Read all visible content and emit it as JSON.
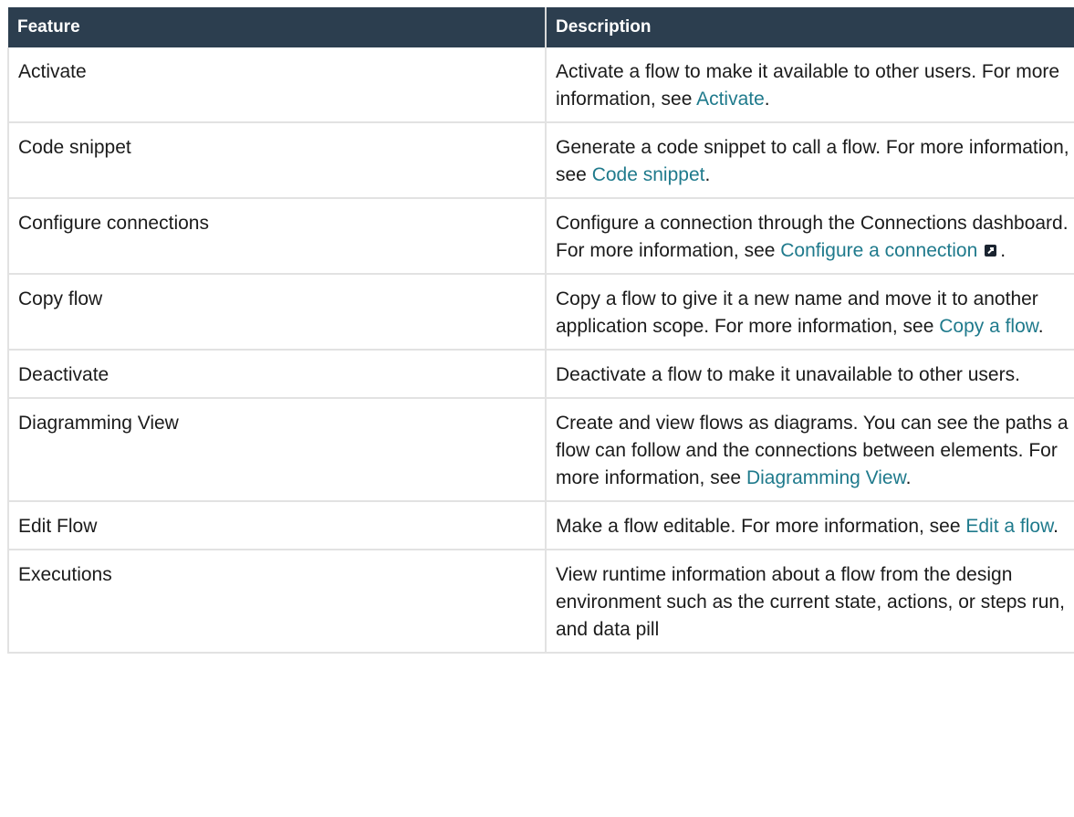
{
  "headers": {
    "feature": "Feature",
    "description": "Description"
  },
  "rows": [
    {
      "feature": "Activate",
      "desc_before": "Activate a flow to make it available to other users. For more information, see ",
      "link": "Activate",
      "desc_after": "."
    },
    {
      "feature": "Code snippet",
      "desc_before": "Generate a code snippet to call a flow. For more information, see ",
      "link": "Code snippet",
      "desc_after": "."
    },
    {
      "feature": "Configure connections",
      "desc_before": "Configure a connection through the Connections dashboard. For more information, see ",
      "link": "Configure a connection",
      "external_icon": "external-link-icon",
      "desc_after": "."
    },
    {
      "feature": "Copy flow",
      "desc_before": "Copy a flow to give it a new name and move it to another application scope. For more information, see ",
      "link": "Copy a flow",
      "desc_after": "."
    },
    {
      "feature": "Deactivate",
      "desc_before": "Deactivate a flow to make it unavailable to other users.",
      "link": "",
      "desc_after": ""
    },
    {
      "feature": "Diagramming View",
      "desc_before": "Create and view flows as diagrams. You can see the paths a flow can follow and the connections between elements. For more information, see ",
      "link": "Diagramming View",
      "desc_after": "."
    },
    {
      "feature": "Edit Flow",
      "desc_before": "Make a flow editable. For more information, see ",
      "link": "Edit a flow",
      "desc_after": "."
    },
    {
      "feature": "Executions",
      "desc_before": "View runtime information about a flow from the design environment such as the current state, actions, or steps run, and data pill",
      "link": "",
      "desc_after": ""
    }
  ]
}
